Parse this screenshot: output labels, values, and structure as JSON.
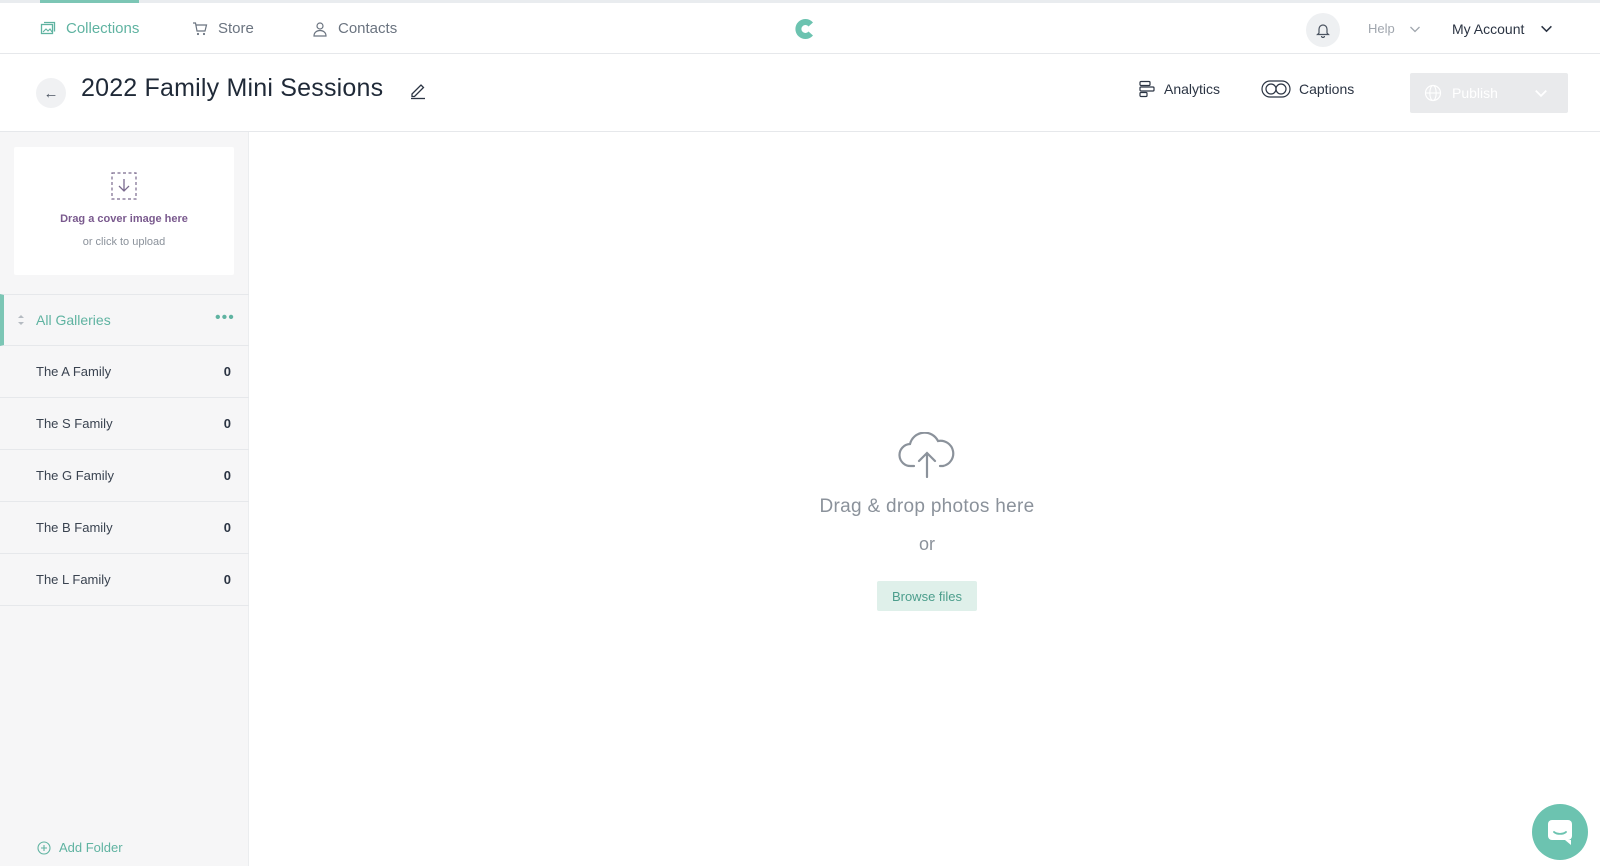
{
  "nav": {
    "collections": "Collections",
    "store": "Store",
    "contacts": "Contacts",
    "help": "Help",
    "account": "My Account"
  },
  "header": {
    "title": "2022 Family Mini Sessions",
    "analytics": "Analytics",
    "captions": "Captions",
    "publish": "Publish"
  },
  "sidebar": {
    "cover_title": "Drag a cover image here",
    "cover_sub": "or click to upload",
    "all_galleries": "All Galleries",
    "folders": [
      {
        "name": "The A Family",
        "count": "0"
      },
      {
        "name": "The S Family",
        "count": "0"
      },
      {
        "name": "The G Family",
        "count": "0"
      },
      {
        "name": "The B Family",
        "count": "0"
      },
      {
        "name": "The L Family",
        "count": "0"
      }
    ],
    "add_folder": "Add Folder"
  },
  "main": {
    "drop_text": "Drag & drop photos here",
    "or_text": "or",
    "browse": "Browse files"
  },
  "colors": {
    "accent": "#5fb3a1",
    "accent_light": "#dff0ea",
    "cover_title": "#7a5a8e",
    "publish_disabled": "#e9eaec"
  },
  "icons": [
    "collections-icon",
    "store-cart-icon",
    "contacts-person-icon",
    "logo-icon",
    "bell-icon",
    "chevron-down-icon",
    "back-arrow-icon",
    "edit-pencil-icon",
    "analytics-icon",
    "captions-icon",
    "globe-icon",
    "cover-download-icon",
    "sort-icon",
    "more-dots-icon",
    "add-circle-icon",
    "upload-cloud-icon",
    "chat-icon"
  ]
}
